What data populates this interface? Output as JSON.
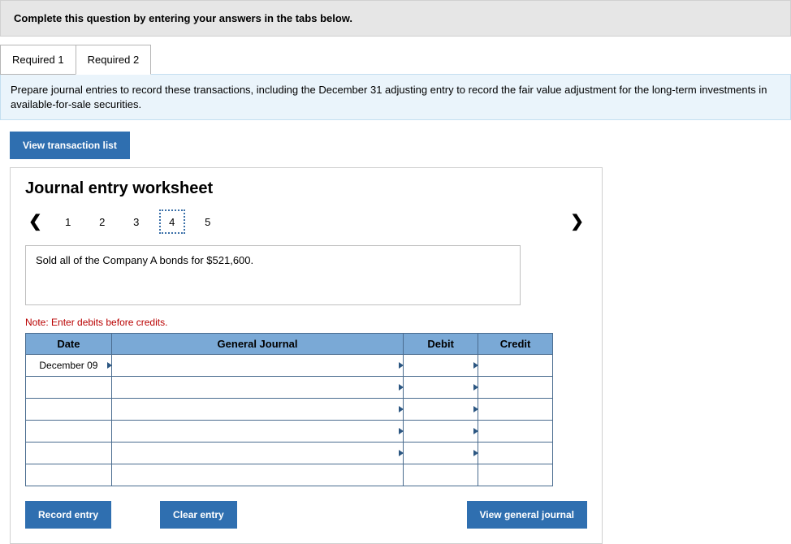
{
  "header": {
    "title": "Complete this question by entering your answers in the tabs below."
  },
  "tabs": [
    {
      "label": "Required 1",
      "active": false
    },
    {
      "label": "Required 2",
      "active": true
    }
  ],
  "instructions": "Prepare journal entries to record these transactions, including the December 31 adjusting entry to record the fair value adjustment for the long-term investments in available-for-sale securities.",
  "buttons": {
    "view_trans": "View transaction list",
    "record": "Record entry",
    "clear": "Clear entry",
    "view_journal": "View general journal"
  },
  "worksheet": {
    "title": "Journal entry worksheet",
    "pages": [
      "1",
      "2",
      "3",
      "4",
      "5"
    ],
    "current_page": "4",
    "description": "Sold all of the Company A bonds for $521,600.",
    "note": "Note: Enter debits before credits.",
    "cols": {
      "date": "Date",
      "gj": "General Journal",
      "debit": "Debit",
      "credit": "Credit"
    },
    "rows": [
      {
        "date": "December 09"
      },
      {
        "date": ""
      },
      {
        "date": ""
      },
      {
        "date": ""
      },
      {
        "date": ""
      },
      {
        "date": ""
      }
    ]
  }
}
